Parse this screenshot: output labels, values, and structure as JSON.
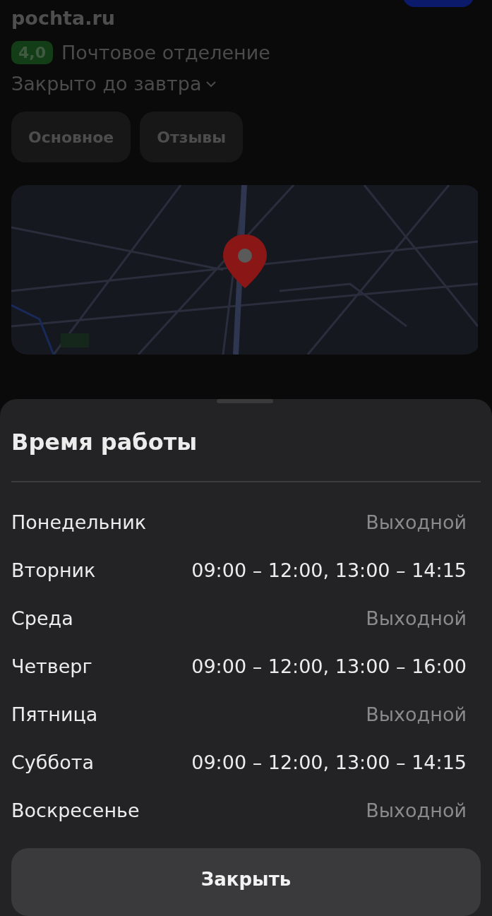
{
  "place": {
    "site": "pochta.ru",
    "rating": "4,0",
    "category": "Почтовое отделение",
    "status": "Закрыто до завтра"
  },
  "tabs": [
    {
      "label": "Основное",
      "selected": false
    },
    {
      "label": "Отзывы",
      "selected": false
    }
  ],
  "sheet": {
    "title": "Время работы",
    "hours": [
      {
        "day": "Понедельник",
        "time": "Выходной",
        "closed": true
      },
      {
        "day": "Вторник",
        "time": "09:00 – 12:00, 13:00 – 14:15",
        "closed": false
      },
      {
        "day": "Среда",
        "time": "Выходной",
        "closed": true
      },
      {
        "day": "Четверг",
        "time": "09:00 – 12:00, 13:00 – 16:00",
        "closed": false
      },
      {
        "day": "Пятница",
        "time": "Выходной",
        "closed": true
      },
      {
        "day": "Суббота",
        "time": "09:00 – 12:00, 13:00 – 14:15",
        "closed": false
      },
      {
        "day": "Воскресенье",
        "time": "Выходной",
        "closed": true
      }
    ],
    "close_button": "Закрыть"
  }
}
